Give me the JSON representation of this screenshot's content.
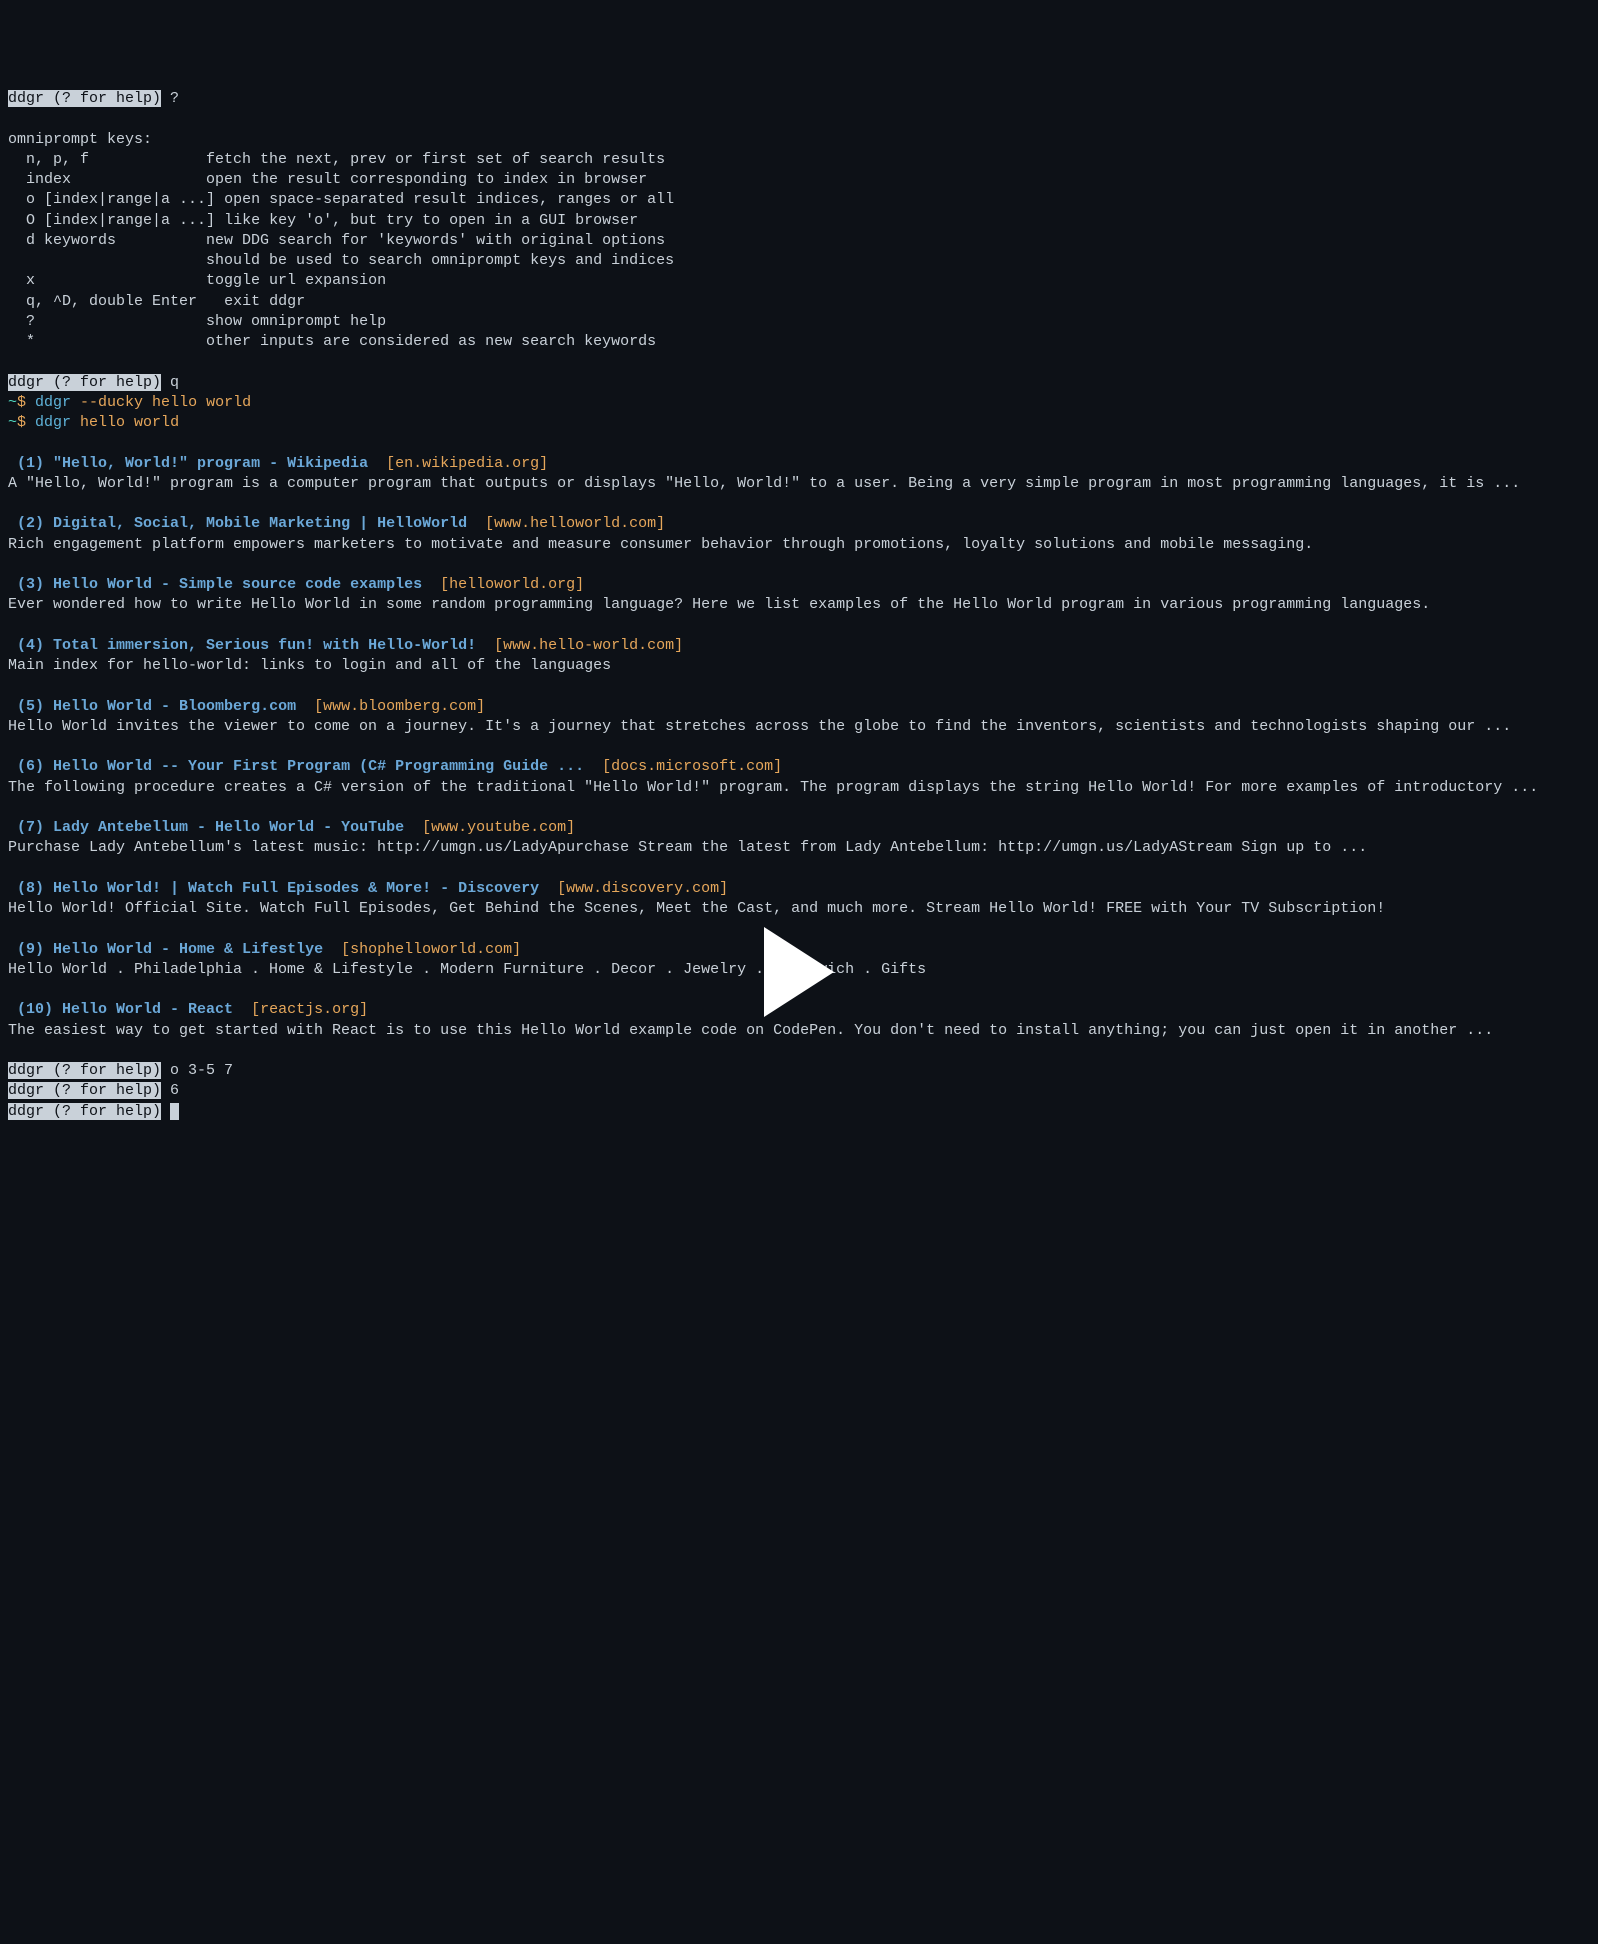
{
  "prompts": {
    "ddgr_help": "ddgr (? for help)",
    "question": " ?",
    "q_cmd": " q",
    "tilde": "~",
    "dollar": "$ ",
    "cmd1_name": "ddgr",
    "cmd1_args": " --ducky hello world",
    "cmd2_name": "ddgr",
    "cmd2_args": " hello world",
    "open_cmd": " o 3-5 7",
    "six_cmd": " 6",
    "final": " "
  },
  "help": {
    "header": "omniprompt keys:",
    "rows": [
      {
        "key": "  n, p, f             ",
        "desc": "fetch the next, prev or first set of search results"
      },
      {
        "key": "  index               ",
        "desc": "open the result corresponding to index in browser"
      },
      {
        "key": "  o [index|range|a ...] ",
        "desc": "open space-separated result indices, ranges or all"
      },
      {
        "key": "  O [index|range|a ...] ",
        "desc": "like key 'o', but try to open in a GUI browser"
      },
      {
        "key": "  d keywords          ",
        "desc": "new DDG search for 'keywords' with original options"
      },
      {
        "key": "                      ",
        "desc": "should be used to search omniprompt keys and indices"
      },
      {
        "key": "  x                   ",
        "desc": "toggle url expansion"
      },
      {
        "key": "  q, ^D, double Enter   ",
        "desc": "exit ddgr"
      },
      {
        "key": "  ?                   ",
        "desc": "show omniprompt help"
      },
      {
        "key": "  *                   ",
        "desc": "other inputs are considered as new search keywords"
      }
    ]
  },
  "results": [
    {
      "idx": " (1) ",
      "title": "\"Hello, World!\" program - Wikipedia",
      "url": "[en.wikipedia.org]",
      "desc": "A \"Hello, World!\" program is a computer program that outputs or displays \"Hello, World!\" to a user. Being a very simple program in most programming languages, it is ..."
    },
    {
      "idx": " (2) ",
      "title": "Digital, Social, Mobile Marketing | HelloWorld",
      "url": "[www.helloworld.com]",
      "desc": "Rich engagement platform empowers marketers to motivate and measure consumer behavior through promotions, loyalty solutions and mobile messaging."
    },
    {
      "idx": " (3) ",
      "title": "Hello World - Simple source code examples",
      "url": "[helloworld.org]",
      "desc": "Ever wondered how to write Hello World in some random programming language? Here we list examples of the Hello World program in various programming languages."
    },
    {
      "idx": " (4) ",
      "title": "Total immersion, Serious fun! with Hello-World!",
      "url": "[www.hello-world.com]",
      "desc": "Main index for hello-world: links to login and all of the languages"
    },
    {
      "idx": " (5) ",
      "title": "Hello World - Bloomberg.com",
      "url": "[www.bloomberg.com]",
      "desc": "Hello World invites the viewer to come on a journey. It's a journey that stretches across the globe to find the inventors, scientists and technologists shaping our ..."
    },
    {
      "idx": " (6) ",
      "title": "Hello World -- Your First Program (C# Programming Guide ...",
      "url": "[docs.microsoft.com]",
      "desc": "The following procedure creates a C# version of the traditional \"Hello World!\" program. The program displays the string Hello World! For more examples of introductory ..."
    },
    {
      "idx": " (7) ",
      "title": "Lady Antebellum - Hello World - YouTube",
      "url": "[www.youtube.com]",
      "desc": "Purchase Lady Antebellum's latest music: http://umgn.us/LadyApurchase Stream the latest from Lady Antebellum: http://umgn.us/LadyAStream Sign up to ..."
    },
    {
      "idx": " (8) ",
      "title": "Hello World! | Watch Full Episodes & More! - Discovery",
      "url": "[www.discovery.com]",
      "desc": "Hello World! Official Site. Watch Full Episodes, Get Behind the Scenes, Meet the Cast, and much more. Stream Hello World! FREE with Your TV Subscription!"
    },
    {
      "idx": " (9) ",
      "title": "Hello World - Home & Lifestlye",
      "url": "[shophelloworld.com]",
      "desc": "Hello World . Philadelphia . Home & Lifestyle . Modern Furniture . Decor . Jewelry . Chilewich . Gifts"
    },
    {
      "idx": " (10) ",
      "title": "Hello World - React",
      "url": "[reactjs.org]",
      "desc": "The easiest way to get started with React is to use this Hello World example code on CodePen. You don't need to install anything; you can just open it in another ..."
    }
  ]
}
